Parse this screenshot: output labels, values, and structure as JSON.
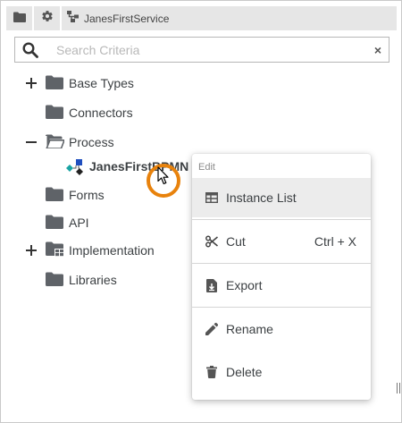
{
  "toolbar": {
    "folder_icon": "folder-icon",
    "settings_icon": "gear-icon",
    "service_icon": "service-hierarchy-icon",
    "breadcrumb_label": "JanesFirstService"
  },
  "search": {
    "placeholder": "Search Criteria",
    "value": "",
    "clear_label": "×"
  },
  "tree": {
    "items": [
      {
        "label": "Base Types",
        "toggle": "+",
        "icon": "folder-icon"
      },
      {
        "label": "Connectors",
        "toggle": "",
        "icon": "folder-icon"
      },
      {
        "label": "Process",
        "toggle": "−",
        "icon": "folder-open-icon"
      },
      {
        "label": "JanesFirstBPMN",
        "toggle": "",
        "icon": "bpmn-model-icon",
        "bold": true
      },
      {
        "label": "Forms",
        "toggle": "",
        "icon": "folder-icon"
      },
      {
        "label": "API",
        "toggle": "",
        "icon": "folder-icon"
      },
      {
        "label": "Implementation",
        "toggle": "+",
        "icon": "folder-grid-icon"
      },
      {
        "label": "Libraries",
        "toggle": "",
        "icon": "folder-icon"
      }
    ]
  },
  "context_menu": {
    "header": "Edit",
    "items": [
      {
        "label": "Instance List",
        "icon": "table-list-icon",
        "shortcut": "",
        "highlighted": true
      },
      {
        "label": "Cut",
        "icon": "scissors-icon",
        "shortcut": "Ctrl + X"
      },
      {
        "label": "Export",
        "icon": "export-file-icon",
        "shortcut": ""
      },
      {
        "label": "Rename",
        "icon": "pencil-icon",
        "shortcut": ""
      },
      {
        "label": "Delete",
        "icon": "trash-icon",
        "shortcut": ""
      }
    ]
  },
  "colors": {
    "highlight_ring": "#e8820c",
    "folder": "#5f6368",
    "menu_hover": "#ececec",
    "bpmn_teal": "#1aa3a3",
    "bpmn_blue": "#1f4fbf"
  }
}
